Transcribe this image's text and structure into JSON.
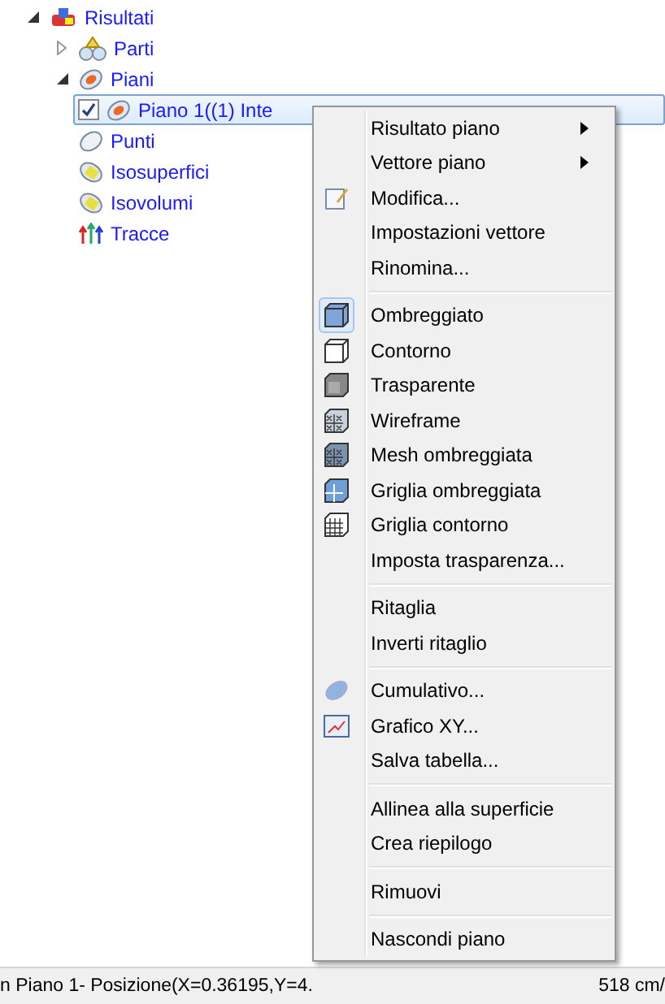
{
  "tree": [
    {
      "label": "Risultati",
      "kind": "results",
      "expanded": true,
      "children": [
        {
          "label": "Parti",
          "kind": "parts",
          "expanded": false
        },
        {
          "label": "Piani",
          "kind": "plane",
          "expanded": true,
          "children": [
            {
              "label": "Piano 1((1) Inte",
              "kind": "plane",
              "checked": true,
              "selected": true
            }
          ]
        },
        {
          "label": "Punti",
          "kind": "points"
        },
        {
          "label": "Isosuperfici",
          "kind": "iso"
        },
        {
          "label": "Isovolumi",
          "kind": "iso"
        },
        {
          "label": "Tracce",
          "kind": "traces"
        }
      ]
    }
  ],
  "context_menu": {
    "groups": [
      [
        {
          "label": "Risultato piano",
          "submenu": true
        },
        {
          "label": "Vettore piano",
          "submenu": true
        },
        {
          "label": "Modifica...",
          "kind": "edit"
        },
        {
          "label": "Impostazioni vettore"
        },
        {
          "label": "Rinomina..."
        }
      ],
      [
        {
          "label": "Ombreggiato",
          "kind": "shaded",
          "checked": true
        },
        {
          "label": "Contorno",
          "kind": "outline",
          "checked": false
        },
        {
          "label": "Trasparente",
          "kind": "transparent",
          "checked": false
        },
        {
          "label": "Wireframe",
          "kind": "wireframe",
          "checked": false
        },
        {
          "label": "Mesh ombreggiata",
          "kind": "mesh",
          "checked": false
        },
        {
          "label": "Griglia ombreggiata",
          "kind": "gridshaded",
          "checked": false
        },
        {
          "label": "Griglia contorno",
          "kind": "gridoutline",
          "checked": false
        },
        {
          "label": "Imposta trasparenza...",
          "checked": false
        }
      ],
      [
        {
          "label": "Ritaglia"
        },
        {
          "label": "Inverti ritaglio"
        }
      ],
      [
        {
          "label": "Cumulativo...",
          "kind": "plane"
        },
        {
          "label": "Grafico XY...",
          "kind": "chart"
        },
        {
          "label": "Salva tabella..."
        }
      ],
      [
        {
          "label": "Allinea alla superficie"
        },
        {
          "label": "Crea riepilogo"
        }
      ],
      [
        {
          "label": "Rimuovi"
        }
      ],
      [
        {
          "label": "Nascondi piano"
        }
      ]
    ]
  },
  "status_bar": {
    "text_left": "n Piano 1- Posizione(X=0.36195,Y=4.",
    "text_right": "518  cm/"
  }
}
